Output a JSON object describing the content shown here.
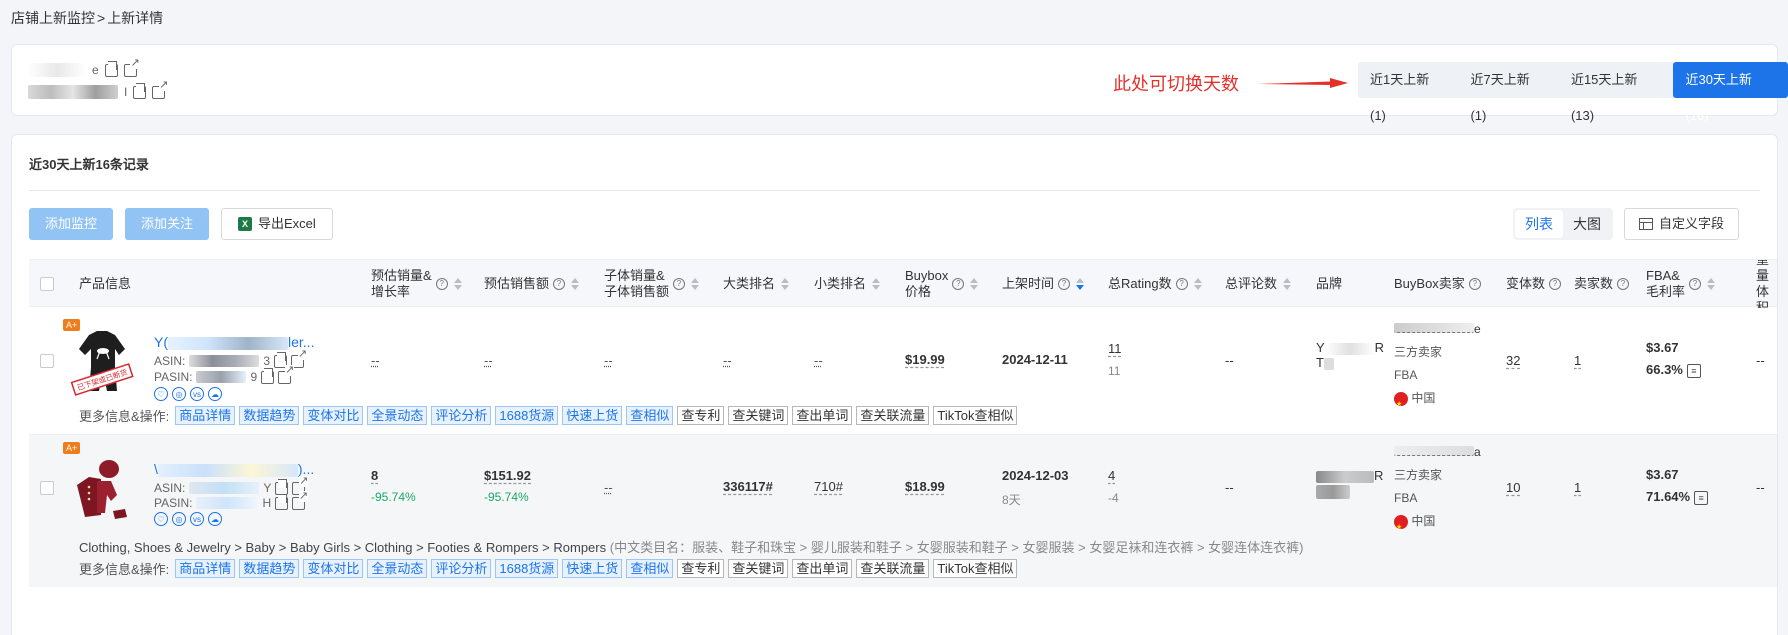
{
  "breadcrumb": {
    "parent": "店铺上新监控",
    "sep": ">",
    "current": "上新详情"
  },
  "store": {
    "line1_suffix": "e",
    "line2_suffix": "I"
  },
  "annotation": "此处可切换天数",
  "day_tabs": [
    {
      "label": "近1天上新 (1)",
      "active": false
    },
    {
      "label": "近7天上新 (1)",
      "active": false
    },
    {
      "label": "近15天上新 (13)",
      "active": false
    },
    {
      "label": "近30天上新 (16)",
      "active": true
    }
  ],
  "record_title": "近30天上新16条记录",
  "toolbar": {
    "add_monitor": "添加监控",
    "add_follow": "添加关注",
    "export": "导出Excel",
    "view_list": "列表",
    "view_grid": "大图",
    "custom_fields": "自定义字段"
  },
  "columns": {
    "product": "产品信息",
    "est_sales_1": "预估销量&",
    "est_sales_2": "增长率",
    "est_revenue": "预估销售额",
    "child_sales_1": "子体销量&",
    "child_sales_2": "子体销售额",
    "main_rank": "大类排名",
    "sub_rank": "小类排名",
    "buybox_1": "Buybox",
    "buybox_2": "价格",
    "listed": "上架时间",
    "rating": "总Rating数",
    "reviews": "总评论数",
    "brand": "品牌",
    "buybox_seller": "BuyBox卖家",
    "variants": "变体数",
    "sellers": "卖家数",
    "fba_1": "FBA&",
    "fba_2": "毛利率",
    "weight_1": "重量",
    "weight_2": "体积"
  },
  "rows": [
    {
      "badge": "A+",
      "title": "Y(",
      "title_tail": "ler...",
      "asin_label": "ASIN: ",
      "asin_tail": "3",
      "pasin_label": "PASIN: ",
      "pasin_tail": "9",
      "stamp": "已下架或已断货",
      "est_sales": "--",
      "est_revenue": "--",
      "child_sales": "--",
      "main_rank": "--",
      "sub_rank": "--",
      "buybox_price": "$19.99",
      "listed_date": "2024-12-11",
      "listed_days": "",
      "rating": "11",
      "rating_sub": "11",
      "reviews": "--",
      "brand_a": "Y",
      "brand_b": "R",
      "brand_c": "T",
      "seller_suffix": "e",
      "seller_type": "三方卖家",
      "fulfil": "FBA",
      "country": "中国",
      "variants": "32",
      "sellers": "1",
      "fba_fee": "$3.67",
      "margin": "66.3%",
      "weight": "--"
    },
    {
      "badge": "A+",
      "title": "\\",
      "title_tail": ")...",
      "asin_label": "ASIN: ",
      "asin_tail": "Y",
      "pasin_label": "PASIN: ",
      "pasin_tail": "H",
      "est_sales": "8",
      "est_sales_growth": "-95.74%",
      "est_revenue": "$151.92",
      "est_revenue_growth": "-95.74%",
      "child_sales": "--",
      "main_rank": "336117#",
      "sub_rank": "710#",
      "buybox_price": "$18.99",
      "listed_date": "2024-12-03",
      "listed_days": "8天",
      "rating": "4",
      "rating_sub": "-4",
      "reviews": "--",
      "brand_b": "R",
      "seller_suffix": "a",
      "seller_type": "三方卖家",
      "fulfil": "FBA",
      "country": "中国",
      "variants": "10",
      "sellers": "1",
      "fba_fee": "$3.67",
      "margin": "71.64%",
      "weight": "--",
      "category_en": "Clothing, Shoes & Jewelry > Baby > Baby Girls > Clothing > Footies & Rompers > Rompers",
      "category_cn": "(中文类目名：服装、鞋子和珠宝 > 婴儿服装和鞋子 > 女婴服装和鞋子 > 女婴服装 > 女婴足袜和连衣裤 > 女婴连体连衣裤)"
    }
  ],
  "ops_label": "更多信息&操作:",
  "ops_tags": [
    "商品详情",
    "数据趋势",
    "变体对比",
    "全景动态",
    "评论分析",
    "1688货源",
    "快速上货",
    "查相似"
  ],
  "ops_plain": [
    "查专利",
    "查关键词",
    "查出单词",
    "查关联流量",
    "TikTok查相似"
  ]
}
